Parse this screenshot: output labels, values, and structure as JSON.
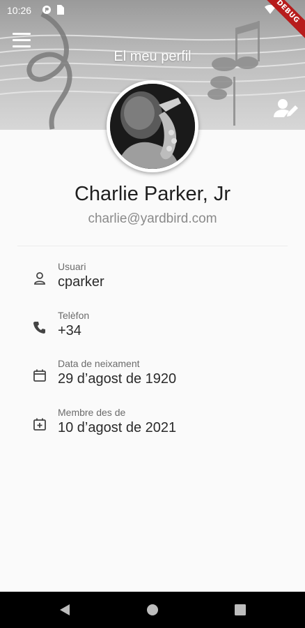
{
  "status_bar": {
    "time": "10:26"
  },
  "debug_banner": "DEBUG",
  "header": {
    "title": "El meu perfil"
  },
  "profile": {
    "name": "Charlie Parker, Jr",
    "email": "charlie@yardbird.com"
  },
  "fields": [
    {
      "label": "Usuari",
      "value": "cparker",
      "icon": "person-icon"
    },
    {
      "label": "Telèfon",
      "value": "+34",
      "icon": "phone-icon"
    },
    {
      "label": "Data de neixament",
      "value": "29 d’agost de 1920",
      "icon": "calendar-icon"
    },
    {
      "label": "Membre des de",
      "value": "10 d’agost de 2021",
      "icon": "calendar-add-icon"
    }
  ],
  "colors": {
    "header_tint": "#bdbdbd",
    "debug": "#b71c1c"
  }
}
